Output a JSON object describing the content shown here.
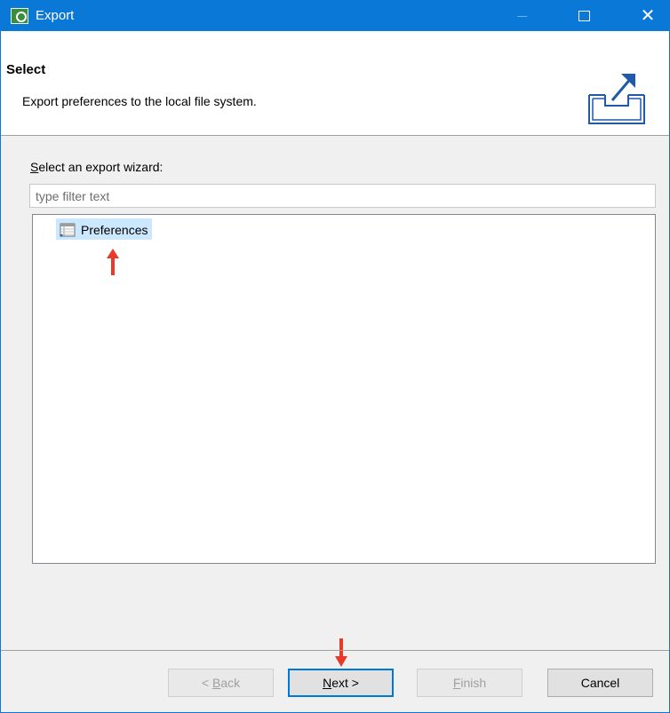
{
  "window": {
    "title": "Export"
  },
  "header": {
    "title": "Select",
    "description": "Export preferences to the local file system."
  },
  "wizard": {
    "label_mnemonic": "S",
    "label_rest": "elect an export wizard:",
    "filter_placeholder": "type filter text",
    "tree_items": [
      {
        "label": "Preferences",
        "icon": "preferences-icon",
        "selected": true
      }
    ]
  },
  "buttons": {
    "back_prefix": "< ",
    "back_mnemonic": "B",
    "back_rest": "ack",
    "next_mnemonic": "N",
    "next_rest": "ext >",
    "finish_mnemonic": "F",
    "finish_rest": "inish",
    "cancel": "Cancel"
  },
  "colors": {
    "titlebar": "#0a78d7",
    "selection": "#cce8ff",
    "annotation_arrow": "#e8392b"
  }
}
